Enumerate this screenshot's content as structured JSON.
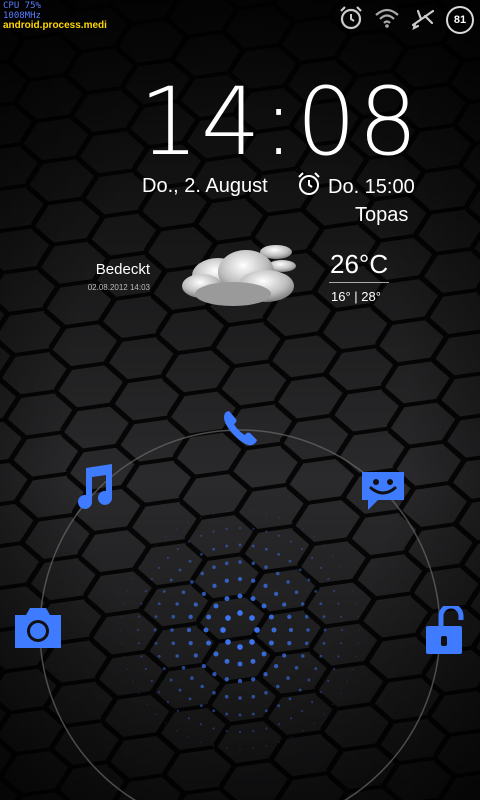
{
  "status_bar": {
    "cpu_line1": "CPU 75%",
    "cpu_line2": "1008MHz",
    "process": "android.process.medi",
    "battery_level": "81",
    "icons": [
      "alarm-icon",
      "wifi-icon",
      "airplane-icon",
      "battery-icon"
    ]
  },
  "lockscreen": {
    "time": "14:08",
    "date": "Do., 2. August",
    "alarm_time": "Do. 15:00",
    "owner_info": "Topas"
  },
  "weather": {
    "condition": "Bedeckt",
    "updated": "02.08.2012 14:03",
    "temperature": "26°C",
    "hi_lo": "16° | 28°",
    "icon": "cloud-icon"
  },
  "unlock_ring": {
    "targets": [
      "phone-icon",
      "music-icon",
      "messaging-icon",
      "camera-icon",
      "unlock-icon"
    ],
    "accent_color": "#3f7bff"
  }
}
